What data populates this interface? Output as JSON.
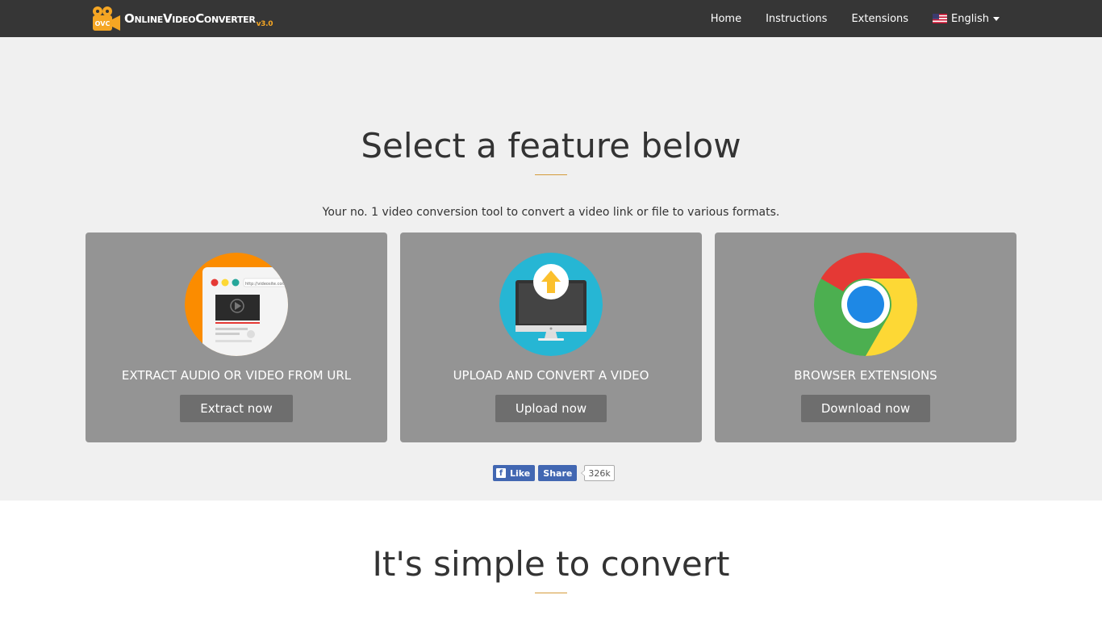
{
  "brand": {
    "name_parts": [
      "O",
      "NLINE",
      "V",
      "IDEO",
      "C",
      "ONVERTER"
    ],
    "version": "v3.0",
    "icon_label": "OVC"
  },
  "nav": {
    "items": [
      {
        "label": "Home"
      },
      {
        "label": "Instructions"
      },
      {
        "label": "Extensions"
      }
    ],
    "language": "English"
  },
  "hero": {
    "title": "Select a feature below",
    "subtitle": "Your no. 1 video conversion tool to convert a video link or file to various formats."
  },
  "cards": [
    {
      "label": "EXTRACT AUDIO OR VIDEO FROM URL",
      "button": "Extract now",
      "icon": "browser-video-icon",
      "url_text": "http://videosite.com"
    },
    {
      "label": "UPLOAD AND CONVERT A VIDEO",
      "button": "Upload now",
      "icon": "monitor-upload-icon"
    },
    {
      "label": "BROWSER EXTENSIONS",
      "button": "Download now",
      "icon": "chrome-icon"
    }
  ],
  "social": {
    "like": "Like",
    "share": "Share",
    "count": "326k"
  },
  "section2": {
    "title": "It's simple to convert"
  },
  "colors": {
    "navbar": "#363636",
    "hero_bg": "#f0f0f0",
    "card_bg": "#949494",
    "button_bg": "#6e6e6e",
    "accent": "#d49b3a",
    "facebook": "#4267b2"
  }
}
